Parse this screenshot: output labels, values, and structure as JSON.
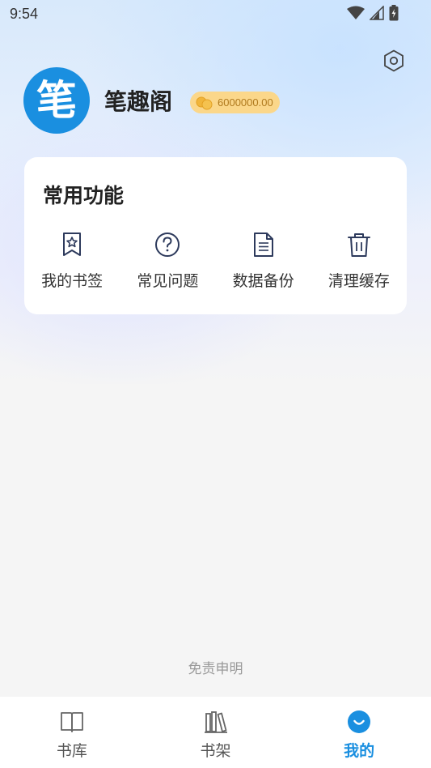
{
  "status_bar": {
    "time": "9:54"
  },
  "profile": {
    "avatar_glyph": "笔",
    "name": "笔趣阁",
    "coins": "6000000.00"
  },
  "common_functions": {
    "title": "常用功能",
    "items": [
      {
        "label": "我的书签",
        "icon": "bookmark-icon"
      },
      {
        "label": "常见问题",
        "icon": "question-icon"
      },
      {
        "label": "数据备份",
        "icon": "document-icon"
      },
      {
        "label": "清理缓存",
        "icon": "trash-icon"
      }
    ]
  },
  "footer": {
    "disclaimer": "免责申明"
  },
  "tab_bar": {
    "active_color": "#1a8fe0",
    "tabs": [
      {
        "label": "书库",
        "icon": "open-book-icon"
      },
      {
        "label": "书架",
        "icon": "bookshelf-icon"
      },
      {
        "label": "我的",
        "icon": "smile-icon",
        "active": true
      }
    ]
  }
}
